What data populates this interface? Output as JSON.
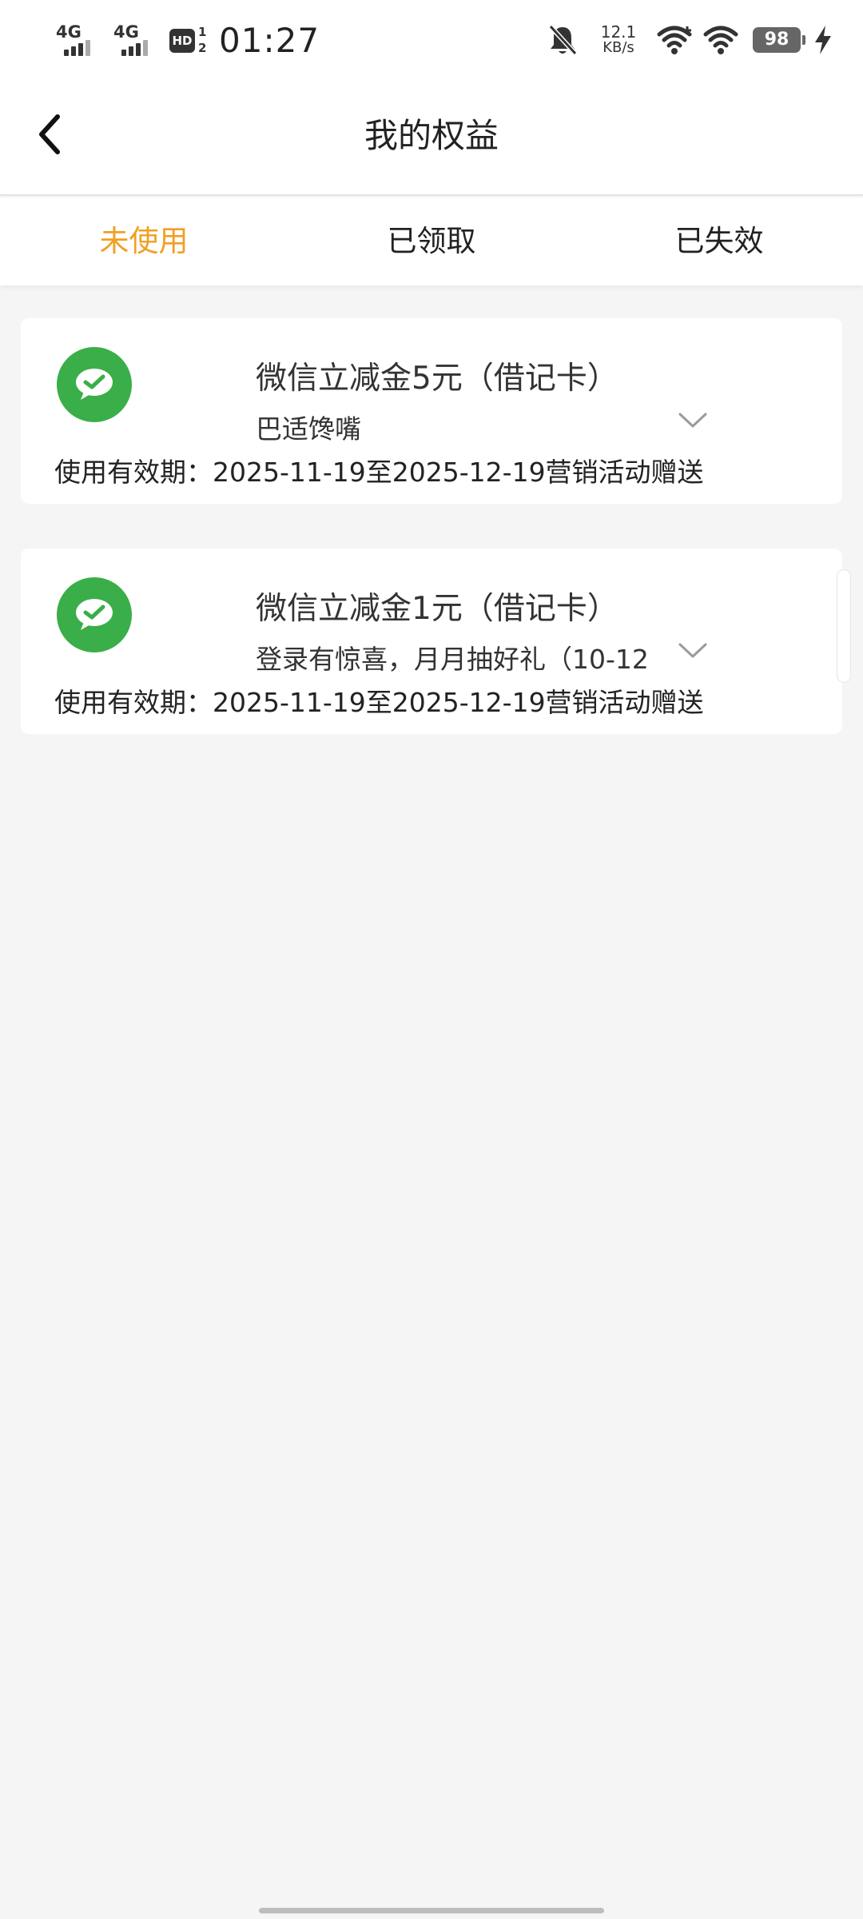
{
  "status_bar": {
    "signal1_label": "4G",
    "signal2_label": "4G",
    "hd_label": "HD",
    "hd_fraction_top": "1",
    "hd_fraction_bottom": "2",
    "time": "01:27",
    "net_rate": "12.1",
    "net_unit": "KB/s",
    "battery": "98",
    "icons": [
      "signal-icon",
      "hd-icon",
      "mute-bell-icon",
      "wifi-plus-icon",
      "wifi-icon",
      "battery-icon",
      "charging-icon"
    ]
  },
  "header": {
    "title": "我的权益",
    "back_icon": "chevron-left-icon"
  },
  "tabs": [
    {
      "label": "未使用",
      "active": true
    },
    {
      "label": "已领取",
      "active": false
    },
    {
      "label": "已失效",
      "active": false
    }
  ],
  "colors": {
    "accent": "#f0a024",
    "wechat_green": "#3aae48",
    "background": "#f5f5f5"
  },
  "cards": [
    {
      "icon": "wechat-pay-icon",
      "title": "微信立减金5元（借记卡）",
      "subtitle": "巴适馋嘴",
      "validity": "使用有效期：2025-11-19至2025-12-19营销活动赠送"
    },
    {
      "icon": "wechat-pay-icon",
      "title": "微信立减金1元（借记卡）",
      "subtitle": "登录有惊喜，月月抽好礼（10-12",
      "validity": "使用有效期：2025-11-19至2025-12-19营销活动赠送"
    }
  ]
}
